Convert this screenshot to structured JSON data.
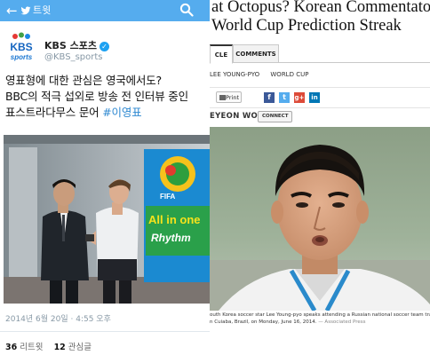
{
  "tweet_panel": {
    "header": {
      "title": "트윗"
    },
    "account": {
      "name": "KBS 스포츠",
      "handle": "@KBS_sports",
      "logo_text": "KBS",
      "logo_sub": "sports"
    },
    "tweet_lines": [
      "영표형에 대한 관심은 영국에서도?",
      "BBC의 적극 섭외로 방송 전 인터뷰 중인",
      "표스트라다무스 문어 "
    ],
    "hashtag": "#이영표",
    "photo_texts": {
      "banner_top": "FIFA",
      "banner_mid": "All in one",
      "banner_bot": "Rhythm"
    },
    "timestamp": "2014년 6월 20일 · 4:55 오후",
    "stats": {
      "retweets_count": "36",
      "retweets_label": "리트윗",
      "favorites_count": "12",
      "favorites_label": "관심글"
    }
  },
  "article_panel": {
    "headline_lines": [
      "at Octopus? Korean Commentato",
      "World Cup Prediction Streak"
    ],
    "tabs": [
      "CLE",
      "COMMENTS"
    ],
    "tags": [
      "LEE YOUNG-PYO",
      "WORLD CUP"
    ],
    "share": {
      "print_label": "Print",
      "icons": [
        "facebook-icon",
        "twitter-icon",
        "google-plus-icon",
        "linkedin-icon"
      ]
    },
    "byline": "EYEON WOO",
    "connect_label": "CONNECT",
    "caption_lines": [
      "outh Korea soccer star Lee Young-pyo speaks attending a Russian national soccer team trai",
      "n Cuiaba, Brazil, on Monday, June 16, 2014."
    ],
    "caption_credit": "— Associated Press"
  },
  "colors": {
    "twitter_blue": "#55acee",
    "link_blue": "#2f89d1",
    "facebook": "#3b5998",
    "twitter_share": "#55acee",
    "google_plus": "#dd4b39",
    "linkedin": "#0077b5"
  }
}
